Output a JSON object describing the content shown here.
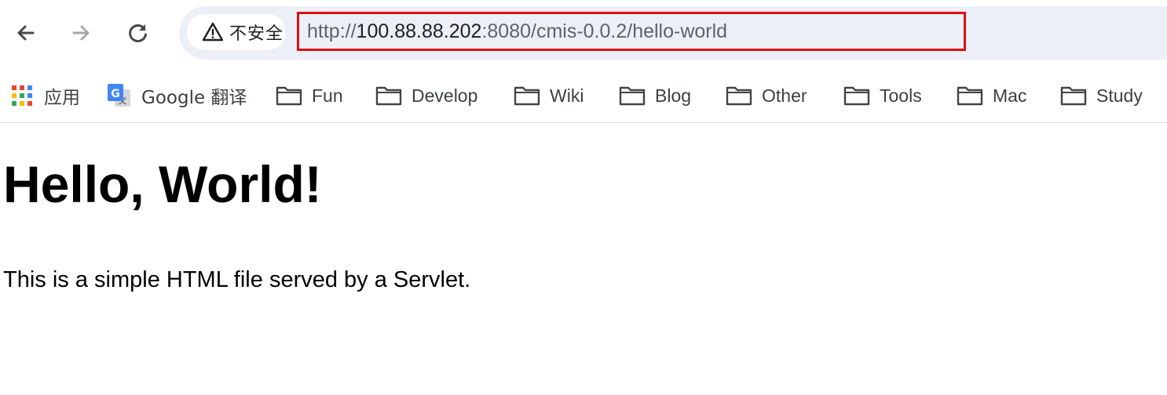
{
  "toolbar": {
    "security_label": "不安全",
    "url_scheme": "http://",
    "url_host": "100.88.88.202",
    "url_rest": ":8080/cmis-0.0.2/hello-world",
    "highlight_color": "#e01010",
    "icons": {
      "back": "arrow-left-icon",
      "forward": "arrow-right-icon",
      "reload": "reload-icon",
      "security": "warning-triangle-icon"
    }
  },
  "bookmarks": {
    "items": [
      {
        "label": "应用",
        "icon": "apps-grid-icon"
      },
      {
        "label": "Google 翻译",
        "icon": "google-translate-icon"
      },
      {
        "label": "Fun",
        "icon": "folder-icon"
      },
      {
        "label": "Develop",
        "icon": "folder-icon"
      },
      {
        "label": "Wiki",
        "icon": "folder-icon"
      },
      {
        "label": "Blog",
        "icon": "folder-icon"
      },
      {
        "label": "Other",
        "icon": "folder-icon"
      },
      {
        "label": "Tools",
        "icon": "folder-icon"
      },
      {
        "label": "Mac",
        "icon": "folder-icon"
      },
      {
        "label": "Study",
        "icon": "folder-icon"
      }
    ]
  },
  "page": {
    "heading": "Hello, World!",
    "paragraph": "This is a simple HTML file served by a Servlet."
  }
}
